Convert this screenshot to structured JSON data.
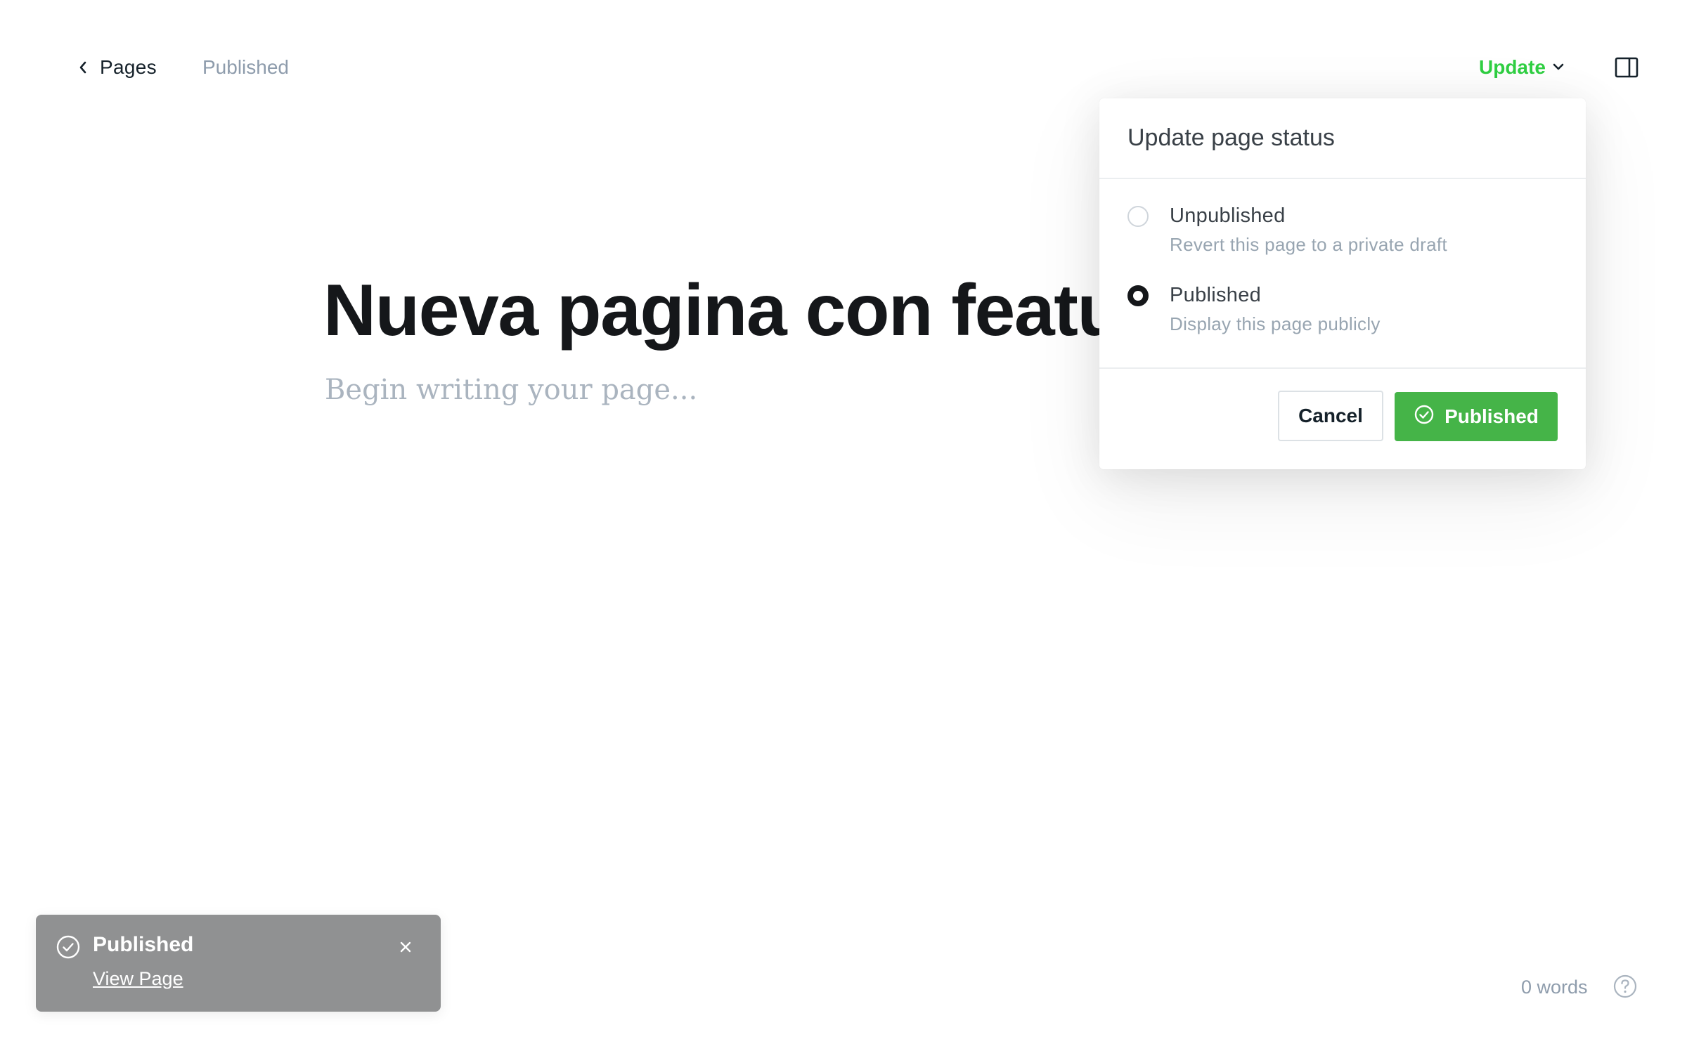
{
  "header": {
    "back_label": "Pages",
    "status": "Published",
    "update_label": "Update"
  },
  "editor": {
    "title": "Nueva pagina con feature",
    "placeholder": "Begin writing your page..."
  },
  "popover": {
    "title": "Update page status",
    "options": [
      {
        "label": "Unpublished",
        "description": "Revert this page to a private draft",
        "selected": false
      },
      {
        "label": "Published",
        "description": "Display this page publicly",
        "selected": true
      }
    ],
    "cancel_label": "Cancel",
    "confirm_label": "Published"
  },
  "toast": {
    "title": "Published",
    "link_label": "View Page"
  },
  "footer": {
    "word_count": "0 words"
  },
  "icons": {
    "back": "chevron-left-icon",
    "update": "chevron-down-icon",
    "sidebar": "sidebar-toggle-icon",
    "confirm": "check-circle-icon",
    "toast": "check-circle-icon",
    "close": "close-icon",
    "help": "question-circle-icon"
  },
  "colors": {
    "accent_green": "#30cf43",
    "button_green": "#45b448",
    "toast_bg": "#909192",
    "muted_text": "#8e9cac"
  }
}
